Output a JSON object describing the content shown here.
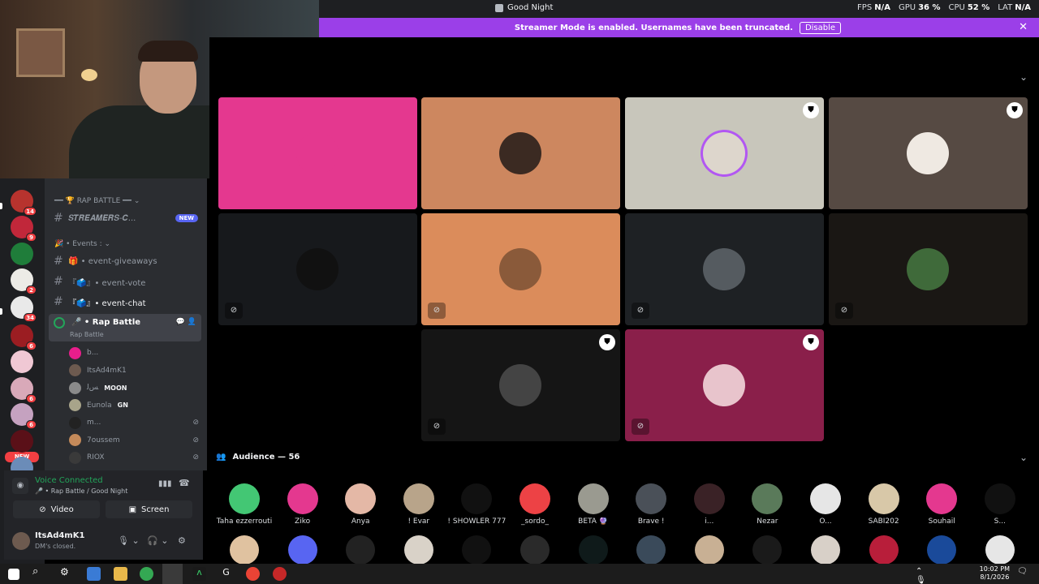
{
  "window": {
    "title": "Good Night"
  },
  "perf": [
    {
      "label": "FPS",
      "value": "N/A"
    },
    {
      "label": "GPU",
      "value": "36 %"
    },
    {
      "label": "CPU",
      "value": "52 %"
    },
    {
      "label": "LAT",
      "value": "N/A"
    }
  ],
  "banner": {
    "text": "Streamer Mode is enabled. Usernames have been truncated.",
    "disable_label": "Disable",
    "close_icon": "close-icon"
  },
  "guilds": [
    {
      "badge": "14",
      "color": "#b7332e"
    },
    {
      "badge": "9",
      "color": "#c1273a"
    },
    {
      "badge": "",
      "color": "#1f7d3a"
    },
    {
      "badge": "2",
      "color": "#ecebe6"
    },
    {
      "badge": "34",
      "color": "#e9e9e9"
    },
    {
      "badge": "6",
      "color": "#9b1d22"
    },
    {
      "badge": "",
      "color": "#f0c8d4"
    },
    {
      "badge": "6",
      "color": "#d9a9b9"
    },
    {
      "badge": "6",
      "color": "#c5a2c0"
    },
    {
      "badge": "",
      "color": "#5a1018"
    },
    {
      "badge": "",
      "color": "#6b8cb8"
    }
  ],
  "guild_new_label": "NEW",
  "channels": {
    "category_rap": "━━ 🏆 RAP BATTLE ━━ ⌄",
    "streamers": "𝑺𝑻𝑹𝑬𝑨𝑴𝑬𝑹𝑺-𝑪...",
    "new_badge": "NEW",
    "category_events": "🎉 • Events : ⌄",
    "event_giveaways": "🎁 • event-giveaways",
    "event_vote": "『🗳️』• event-vote",
    "event_chat": "『🗳️』• event-chat",
    "voice": {
      "name": "🎤 • Rap Battle",
      "sub": "Rap Battle"
    },
    "voice_users": [
      {
        "name": "b...",
        "tag": "",
        "color": "#e91e8c",
        "muted": false
      },
      {
        "name": "ItsAd4mK1",
        "tag": "",
        "color": "#6d5a4f",
        "muted": false
      },
      {
        "name": "ﺲﻟ",
        "tag": "MOON",
        "color": "#8a8a8a",
        "muted": false
      },
      {
        "name": "Eunola",
        "tag": "GN",
        "color": "#a8a48a",
        "muted": false
      },
      {
        "name": "m...",
        "tag": "",
        "color": "#222",
        "muted": true
      },
      {
        "name": "7oussem",
        "tag": "",
        "color": "#c48a5a",
        "muted": true
      },
      {
        "name": "RIOX",
        "tag": "",
        "color": "#3a3a3a",
        "muted": true
      }
    ]
  },
  "voice_panel": {
    "title": "Voice Connected",
    "sub": "🎤 • Rap Battle / Good Night",
    "video_label": "Video",
    "screen_label": "Screen"
  },
  "user_panel": {
    "name": "ItsAd4mK1",
    "status": "DM's closed."
  },
  "stage_tiles": [
    {
      "bg": "#e4388f",
      "av": "#e4388f",
      "mod": false,
      "mic": false
    },
    {
      "bg": "#cd875f",
      "av": "#3b2a22",
      "mod": false,
      "mic": false
    },
    {
      "bg": "#c8c6bb",
      "av": "#ddd6cc",
      "mod": true,
      "mic": false
    },
    {
      "bg": "#564a43",
      "av": "#efe9e2",
      "mod": true,
      "mic": false
    },
    {
      "bg": "#17191c",
      "av": "#111",
      "mod": false,
      "mic": true
    },
    {
      "bg": "#db8c5b",
      "av": "#8a5a3a",
      "mod": false,
      "mic": true
    },
    {
      "bg": "#1e2124",
      "av": "#555b60",
      "mod": false,
      "mic": true
    },
    {
      "bg": "#1a1714",
      "av": "#3f6a3a",
      "mod": false,
      "mic": true
    },
    {
      "bg": "#151515",
      "av": "#444",
      "mod": true,
      "mic": true
    },
    {
      "bg": "#8a1f4a",
      "av": "#e8c4cc",
      "mod": true,
      "mic": true
    }
  ],
  "audience": {
    "title": "Audience — 56",
    "members": [
      {
        "name": "Taha ezzerrouti",
        "color": "#43c774"
      },
      {
        "name": "Ziko",
        "color": "#e4388f"
      },
      {
        "name": "Anya",
        "color": "#e4b8a6"
      },
      {
        "name": "! Evar",
        "color": "#b8a48a"
      },
      {
        "name": "! SHOWLER 777",
        "color": "#111"
      },
      {
        "name": "_sordo_",
        "color": "#ed4245"
      },
      {
        "name": "BETA 🔮",
        "color": "#9a9a90"
      },
      {
        "name": "Brave !",
        "color": "#4a5058"
      },
      {
        "name": "i...",
        "color": "#3a2226"
      },
      {
        "name": "Nezar",
        "color": "#5a7a5a"
      },
      {
        "name": "O...",
        "color": "#e6e6e6"
      },
      {
        "name": "SABI202",
        "color": "#d8c8a8"
      },
      {
        "name": "Souhail",
        "color": "#e4388f"
      },
      {
        "name": "S...",
        "color": "#111"
      }
    ],
    "row2": [
      "#e0c2a0",
      "#5865f2",
      "#222",
      "#d9d2c8",
      "#111",
      "#2a2a2a",
      "#0f1a1a",
      "#3a4a5a",
      "#c8b094",
      "#1a1a1a",
      "#d8d0c8",
      "#b81e3a",
      "#1a4a9a",
      "#e6e6e6"
    ]
  },
  "taskbar": {
    "time": "10:02 PM",
    "date": "8/1/2026"
  }
}
